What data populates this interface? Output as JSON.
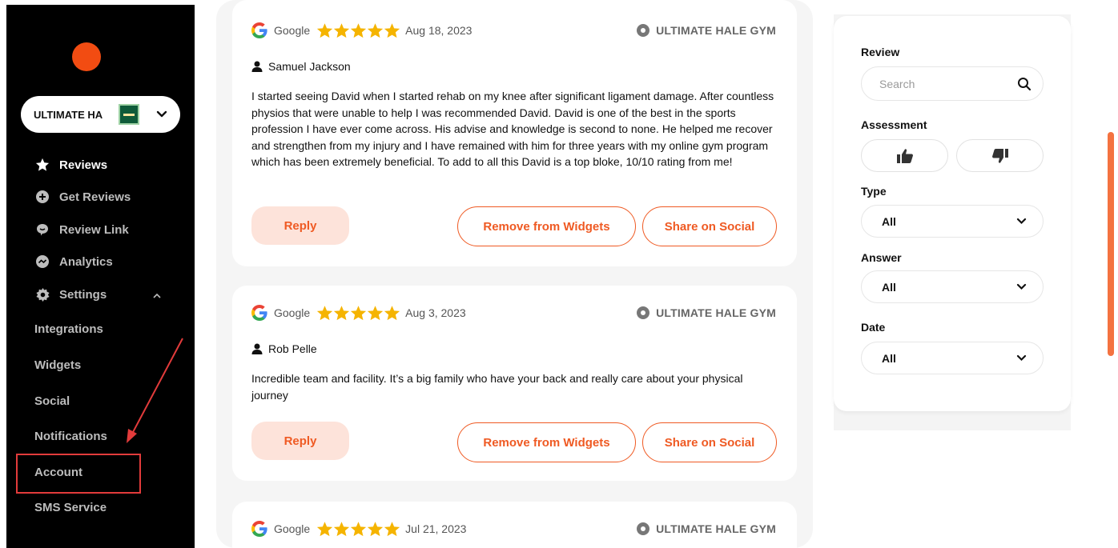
{
  "sidebar": {
    "account_name": "ULTIMATE HA",
    "nav": [
      {
        "label": "Reviews",
        "icon": "star-badge-icon",
        "active": true
      },
      {
        "label": "Get Reviews",
        "icon": "plus-circle-icon",
        "active": false
      },
      {
        "label": "Review Link",
        "icon": "chat-bubble-icon",
        "active": false
      },
      {
        "label": "Analytics",
        "icon": "chart-circle-icon",
        "active": false
      },
      {
        "label": "Settings",
        "icon": "gear-icon",
        "active": false
      }
    ],
    "settings_sub": [
      "Integrations",
      "Widgets",
      "Social",
      "Notifications",
      "Account",
      "SMS Service"
    ]
  },
  "reviews": [
    {
      "source": "Google",
      "rating": 5,
      "date": "Aug 18, 2023",
      "location": "ULTIMATE HALE GYM",
      "author": "Samuel Jackson",
      "text": "I started seeing David when I started rehab on my knee after significant ligament damage. After countless physios that were unable to help I was recommended David. David is one of the best in the sports profession I have ever come across. His advise and knowledge is second to none. He helped me recover and strengthen from my injury and I have remained with him for three years with my online gym program which has been extremely beneficial. To add to all this David is a top bloke, 10/10 rating from me!",
      "reply_label": "Reply",
      "remove_label": "Remove from Widgets",
      "share_label": "Share on Social"
    },
    {
      "source": "Google",
      "rating": 5,
      "date": "Aug 3, 2023",
      "location": "ULTIMATE HALE GYM",
      "author": "Rob Pelle",
      "text": "Incredible team and facility. It’s a big family who have your back and really care about your physical journey",
      "reply_label": "Reply",
      "remove_label": "Remove from Widgets",
      "share_label": "Share on Social"
    },
    {
      "source": "Google",
      "rating": 5,
      "date": "Jul 21, 2023",
      "location": "ULTIMATE HALE GYM"
    }
  ],
  "filters": {
    "review_label": "Review",
    "search_placeholder": "Search",
    "assessment_label": "Assessment",
    "type_label": "Type",
    "type_value": "All",
    "answer_label": "Answer",
    "answer_value": "All",
    "date_label": "Date",
    "date_value": "All"
  },
  "colors": {
    "brand": "#f24c12",
    "accent": "#ef5a23",
    "star": "#f5b400",
    "highlight": "#e23b3b"
  }
}
